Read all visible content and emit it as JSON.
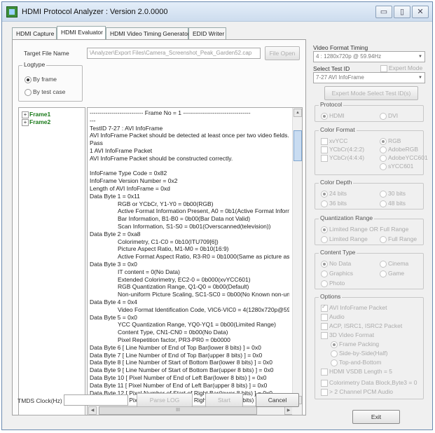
{
  "window": {
    "title": "HDMI Protocol Analyzer : Version  2.0.0000",
    "controls": [
      "▭",
      "▯",
      "✕"
    ]
  },
  "tabs": [
    {
      "label": "HDMI Capture"
    },
    {
      "label": "HDMI Evaluator",
      "active": true
    },
    {
      "label": "HDMI Video Timing Generator"
    },
    {
      "label": "EDID Writer"
    }
  ],
  "target_file": {
    "label": "Target File Name",
    "value": "\\Analyzer\\Export Files\\Camera_Screenshot_Peak_Garden52.cap",
    "button": "File Open"
  },
  "logtype": {
    "title": "Logtype",
    "options": [
      {
        "label": "By frame",
        "checked": true
      },
      {
        "label": "By test case",
        "checked": false
      }
    ]
  },
  "tree": {
    "items": [
      "Frame1",
      "Frame2"
    ]
  },
  "log": {
    "lines": [
      {
        "text": "--------------------------- Frame No = 1 ----------------------------------",
        "indent": 0
      },
      {
        "text": "---",
        "indent": 0
      },
      {
        "text": "TestID 7-27 : AVI InfoFrame",
        "indent": 0
      },
      {
        "text": "AVI InfoFrame Packet should be detected at least once per two video fields.",
        "indent": 0
      },
      {
        "text": "Pass",
        "indent": 0
      },
      {
        "text": "1 AVI InfoFrame Packet",
        "indent": 0
      },
      {
        "text": "AVI InfoFrame Packet should be constructed correctly.",
        "indent": 0
      },
      {
        "text": "",
        "indent": 0
      },
      {
        "text": "InfoFrame Type Code = 0x82",
        "indent": 0
      },
      {
        "text": "InfoFrame Version Number = 0x2",
        "indent": 0
      },
      {
        "text": "Length of AVI InfoFrame = 0xd",
        "indent": 0
      },
      {
        "text": "Data Byte 1 = 0x11",
        "indent": 0
      },
      {
        "text": "RGB or YCbCr, Y1-Y0 = 0b00(RGB)",
        "indent": 1
      },
      {
        "text": "Active Format Information Present, A0 = 0b1(Active Format Informati",
        "indent": 1
      },
      {
        "text": "Bar Information, B1-B0 = 0b00(Bar Data not Valid)",
        "indent": 1
      },
      {
        "text": "Scan Information, S1-S0 = 0b01(Overscanned(television))",
        "indent": 1
      },
      {
        "text": "Data Byte 2 = 0xa8",
        "indent": 0
      },
      {
        "text": "Colorimetry, C1-C0 = 0b10(ITU709[6])",
        "indent": 1
      },
      {
        "text": "Picture Aspect Ratio, M1-M0 = 0b10(16:9)",
        "indent": 1
      },
      {
        "text": "Active Format Aspect Ratio, R3-R0 = 0b1000(Same as picture asp",
        "indent": 1
      },
      {
        "text": "Data Byte 3 = 0x0",
        "indent": 0
      },
      {
        "text": "IT content = 0(No Data)",
        "indent": 1
      },
      {
        "text": "Extended Colorimetry, EC2-0 = 0b000(xvYCC601)",
        "indent": 1
      },
      {
        "text": "RGB Quantization Range, Q1-Q0 = 0b00(Default)",
        "indent": 1
      },
      {
        "text": "Non-uniform Picture Scaling, SC1-SC0 = 0b00(No Known non-unif",
        "indent": 1
      },
      {
        "text": "Data Byte 4 = 0x4",
        "indent": 0
      },
      {
        "text": "Video Format Identification Code, VIC6-VIC0 = 4(1280x720p@59.9",
        "indent": 1
      },
      {
        "text": "Data Byte 5 = 0x0",
        "indent": 0
      },
      {
        "text": "YCC Quantization Range, YQ0-YQ1 = 0b00(Limited Range)",
        "indent": 1
      },
      {
        "text": "Content Type, CN1-CN0 = 0b00(No Data)",
        "indent": 1
      },
      {
        "text": "Pixel Repetition factor, PR3-PR0 = 0b0000",
        "indent": 1
      },
      {
        "text": "Data Byte  6 [ Line Number of End of Top Bar(lower 8 bits) ] = 0x0",
        "indent": 0
      },
      {
        "text": "Data Byte  7 [ Line Number of End of Top Bar(upper 8 bits) ] = 0x0",
        "indent": 0
      },
      {
        "text": "Data Byte  8 [ Line Number of Start of Bottom Bar(lower 8 bits) ] = 0x0",
        "indent": 0
      },
      {
        "text": "Data Byte  9 [ Line Number of Start of Bottom Bar(upper 8 bits) ] = 0x0",
        "indent": 0
      },
      {
        "text": "Data Byte 10 [ Pixel Number of End of Left Bar(lower 8 bits) ] = 0x0",
        "indent": 0
      },
      {
        "text": "Data Byte 11 [ Pixel Number of End of Left Bar(upper 8 bits) ] = 0x0",
        "indent": 0
      },
      {
        "text": "Data Byte 12 [ Pixel Number of Start of Right Bar(lower 8 bits) ] = 0x0",
        "indent": 0
      },
      {
        "text": "Data Byte 13 [ Pixel Number of Start of Right Bar(upper 8 bits) ] = 0x0",
        "indent": 0
      }
    ],
    "hscroll_label": "III"
  },
  "bottom": {
    "tmds_label": "TMDS Clock(Hz)",
    "tmds_value": "",
    "parse_log": "Parse LOG",
    "start": "Start",
    "cancel": "Cancel"
  },
  "right": {
    "video_format_timing": {
      "label": "Video Format Timing",
      "value": "4 : 1280x720p @ 59.94Hz"
    },
    "select_test_id": {
      "label": "Select Test ID",
      "expert_mode": "Expert Mode",
      "value": "7-27 AVI InfoFrame",
      "expert_button": "Expert Mode Select Test ID(s)"
    },
    "protocol": {
      "title": "Protocol",
      "options": [
        {
          "label": "HDMI",
          "checked": true
        },
        {
          "label": "DVI",
          "checked": false
        }
      ]
    },
    "color_format": {
      "title": "Color Format",
      "left": [
        {
          "label": "xvYCC",
          "type": "check"
        },
        {
          "label": "YCbCr(4:2:2)",
          "type": "check"
        },
        {
          "label": "YCbCr(4:4:4)",
          "type": "check"
        }
      ],
      "right": [
        {
          "label": "RGB",
          "checked": true
        },
        {
          "label": "AdobeRGB",
          "checked": false
        },
        {
          "label": "AdobeYCC601",
          "checked": false
        },
        {
          "label": "sYCC601",
          "checked": false
        }
      ]
    },
    "color_depth": {
      "title": "Color Depth",
      "options": [
        {
          "label": "24 bits",
          "checked": true
        },
        {
          "label": "30 bits",
          "checked": false
        },
        {
          "label": "36 bits",
          "checked": false
        },
        {
          "label": "48 bits",
          "checked": false
        }
      ]
    },
    "quantization_range": {
      "title": "Quantization Range",
      "options": [
        {
          "label": "Limited Range OR Full Range",
          "checked": true
        },
        {
          "label": "Limited Range",
          "checked": false
        },
        {
          "label": "Full Range",
          "checked": false
        }
      ]
    },
    "content_type": {
      "title": "Content Type",
      "options": [
        {
          "label": "No Data",
          "checked": true
        },
        {
          "label": "Cinema",
          "checked": false
        },
        {
          "label": "Graphics",
          "checked": false
        },
        {
          "label": "Game",
          "checked": false
        },
        {
          "label": "Photo",
          "checked": false
        }
      ]
    },
    "options": {
      "title": "Options",
      "items": [
        {
          "label": "AVI InfoFrame Packet",
          "checked": true
        },
        {
          "label": "Audio",
          "checked": false
        },
        {
          "label": "ACP, ISRC1, ISRC2 Packet",
          "checked": false
        },
        {
          "label": "3D Video Format",
          "checked": false
        }
      ],
      "format_3d": [
        {
          "label": "Frame Packing",
          "checked": true
        },
        {
          "label": "Side-by-Side(Half)",
          "checked": false
        },
        {
          "label": "Top-and-Bottom",
          "checked": false
        }
      ],
      "more": [
        {
          "label": "HDMI VSDB Length = 5",
          "checked": false
        },
        {
          "label": "Colorimetry Data Block,Byte3 = 0",
          "checked": false
        },
        {
          "label": "> 2 Channel PCM Audio",
          "checked": false
        }
      ]
    },
    "exit": "Exit"
  }
}
